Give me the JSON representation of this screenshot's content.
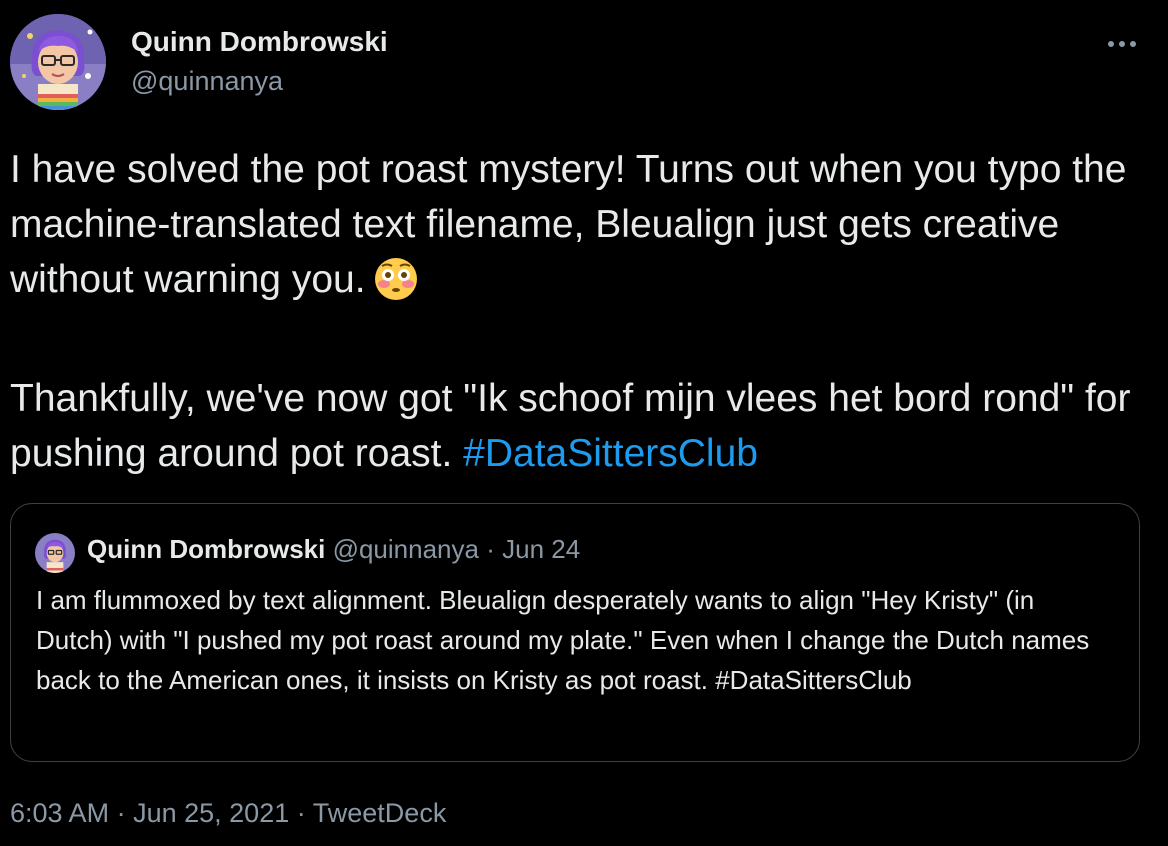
{
  "author": {
    "name": "Quinn Dombrowski",
    "handle": "@quinnanya",
    "avatar_icon": "avatar-illustration"
  },
  "more_icon": "more-horizontal-icon",
  "tweet": {
    "line1": "I have solved the pot roast mystery! Turns out when you typo the machine-translated text filename, Bleualign just gets creative without warning you.",
    "emoji": "flushed-face-emoji",
    "line2": "Thankfully, we've now got \"Ik schoof mijn vlees het bord rond\" for pushing around pot roast.",
    "hashtag": "#DataSittersClub"
  },
  "quote": {
    "name": "Quinn Dombrowski",
    "handle": "@quinnanya",
    "separator": "·",
    "date": "Jun 24",
    "text": "I am flummoxed by text alignment. Bleualign desperately wants to align \"Hey Kristy\" (in Dutch) with \"I pushed my pot roast around my plate.\" Even when I change the Dutch names back to the American ones, it insists on Kristy as pot roast.",
    "hashtag": "#DataSittersClub"
  },
  "footer": {
    "time": "6:03 AM",
    "separator": "·",
    "date": "Jun 25, 2021",
    "source": "TweetDeck"
  },
  "colors": {
    "background": "#000000",
    "text": "#e7e9ea",
    "secondary": "#8b98a5",
    "link": "#1d9bf0",
    "border": "#3e4144"
  }
}
